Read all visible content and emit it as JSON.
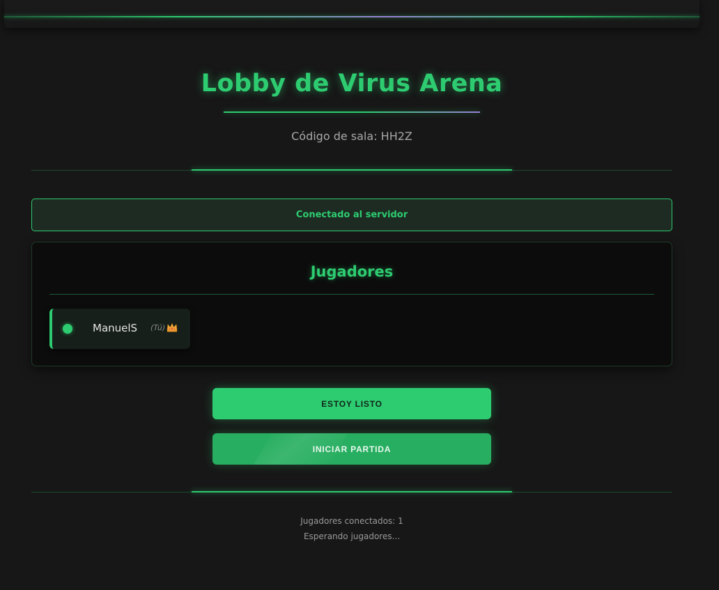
{
  "header": {
    "title": "Lobby de Virus Arena",
    "room_code_label": "Código de sala:",
    "room_code": "HH2Z"
  },
  "connection": {
    "status": "Conectado al servidor"
  },
  "players_panel": {
    "title": "Jugadores",
    "players": [
      {
        "name": "ManuelS",
        "tag": "(Tú)",
        "icon": "crown-icon",
        "status_color": "#2ecc71"
      }
    ]
  },
  "actions": {
    "ready_label": "ESTOY LISTO",
    "start_label": "INICIAR PARTIDA"
  },
  "footer": {
    "connected_label": "Jugadores conectados:",
    "connected_count": "1",
    "waiting": "Esperando jugadores..."
  },
  "colors": {
    "accent": "#2ecc71",
    "accent_dark": "#27ae60",
    "purple_accent": "#9b7fd6",
    "background": "#171717"
  }
}
